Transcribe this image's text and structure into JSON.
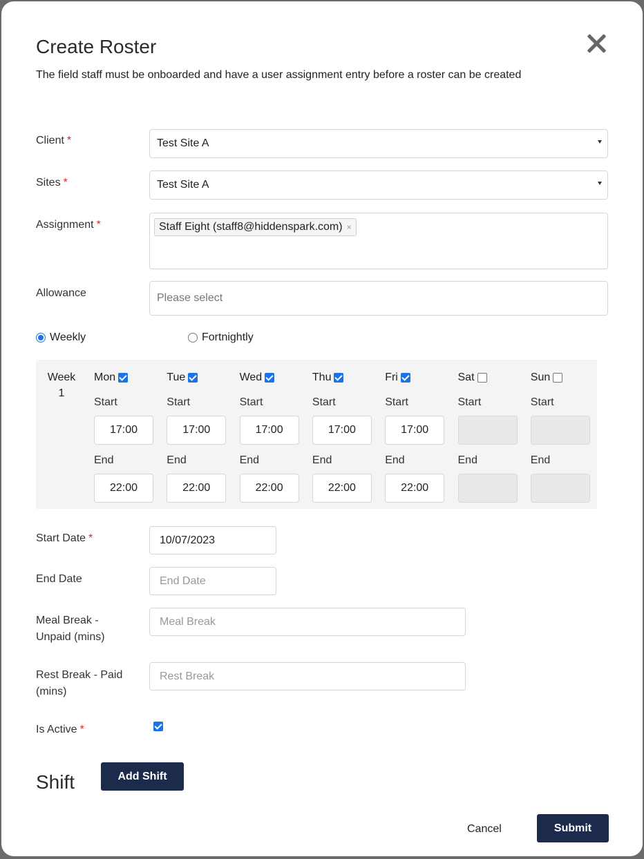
{
  "modal": {
    "title": "Create Roster",
    "subtitle": "The field staff must be onboarded and have a user assignment entry before a roster can be created"
  },
  "form": {
    "client": {
      "label": "Client",
      "required_mark": "*",
      "value": "Test Site A"
    },
    "sites": {
      "label": "Sites",
      "required_mark": "*",
      "value": "Test Site A"
    },
    "assignment": {
      "label": "Assignment",
      "required_mark": "*",
      "tags": [
        "Staff Eight (staff8@hiddenspark.com)"
      ],
      "tag_remove": "×"
    },
    "allowance": {
      "label": "Allowance",
      "placeholder": "Please select"
    },
    "frequency": {
      "options": [
        {
          "label": "Weekly",
          "selected": true
        },
        {
          "label": "Fortnightly",
          "selected": false
        }
      ]
    },
    "schedule": {
      "week_label_line1": "Week",
      "week_label_line2": "1",
      "start_label": "Start",
      "end_label": "End",
      "days": [
        {
          "name": "Mon",
          "checked": true,
          "start": "17:00",
          "end": "22:00"
        },
        {
          "name": "Tue",
          "checked": true,
          "start": "17:00",
          "end": "22:00"
        },
        {
          "name": "Wed",
          "checked": true,
          "start": "17:00",
          "end": "22:00"
        },
        {
          "name": "Thu",
          "checked": true,
          "start": "17:00",
          "end": "22:00"
        },
        {
          "name": "Fri",
          "checked": true,
          "start": "17:00",
          "end": "22:00"
        },
        {
          "name": "Sat",
          "checked": false,
          "start": "",
          "end": ""
        },
        {
          "name": "Sun",
          "checked": false,
          "start": "",
          "end": ""
        }
      ]
    },
    "start_date": {
      "label": "Start Date",
      "required_mark": "*",
      "value": "10/07/2023"
    },
    "end_date": {
      "label": "End Date",
      "placeholder": "End Date"
    },
    "meal_break": {
      "label_line1": "Meal Break -",
      "label_line2": "Unpaid (mins)",
      "placeholder": "Meal Break"
    },
    "rest_break": {
      "label_line1": "Rest Break - Paid",
      "label_line2": "(mins)",
      "placeholder": "Rest Break"
    },
    "is_active": {
      "label": "Is Active",
      "required_mark": "*",
      "checked": true
    }
  },
  "shift": {
    "title": "Shift",
    "add_label": "Add Shift"
  },
  "footer": {
    "cancel_label": "Cancel",
    "submit_label": "Submit"
  },
  "colors": {
    "primary_button": "#1c2b4b",
    "checkbox_accent": "#1a73e8",
    "required": "#e02424"
  }
}
